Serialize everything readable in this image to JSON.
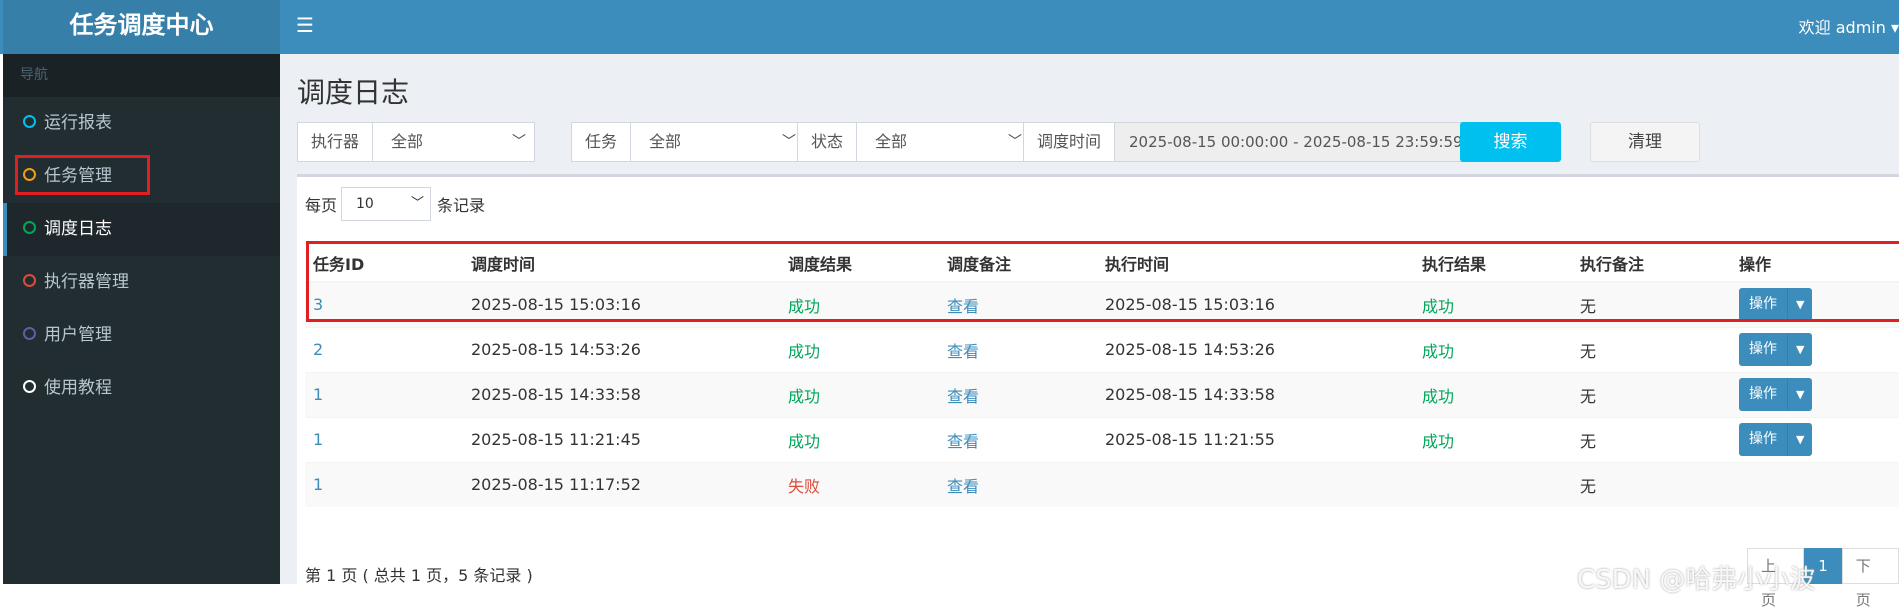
{
  "app": {
    "title": "任务调度中心",
    "menu_icon": "hamburger-icon",
    "welcome": "欢迎 admin"
  },
  "sidebar": {
    "header": "导航",
    "items": [
      {
        "label": "运行报表",
        "icon_color": "#00c0ef"
      },
      {
        "label": "任务管理",
        "icon_color": "#f39c12"
      },
      {
        "label": "调度日志",
        "icon_color": "#00a65a",
        "active": true
      },
      {
        "label": "执行器管理",
        "icon_color": "#dd4b39"
      },
      {
        "label": "用户管理",
        "icon_color": "#605ca8"
      },
      {
        "label": "使用教程",
        "icon_color": "#ffffff"
      }
    ]
  },
  "page": {
    "title": "调度日志"
  },
  "filters": {
    "executor_label": "执行器",
    "executor_value": "全部",
    "job_label": "任务",
    "job_value": "全部",
    "status_label": "状态",
    "status_value": "全部",
    "time_label": "调度时间",
    "time_value": "2025-08-15 00:00:00 - 2025-08-15 23:59:59",
    "search_label": "搜索",
    "clear_label": "清理"
  },
  "length": {
    "prefix": "每页",
    "value": "10",
    "suffix": "条记录"
  },
  "table": {
    "headers": [
      "任务ID",
      "调度时间",
      "调度结果",
      "调度备注",
      "执行时间",
      "执行结果",
      "执行备注",
      "操作"
    ],
    "rows": [
      {
        "id": "3",
        "trigger_time": "2025-08-15 15:03:16",
        "trigger_result": "成功",
        "trigger_note": "查看",
        "exec_time": "2025-08-15 15:03:16",
        "exec_result": "成功",
        "exec_note": "无",
        "op": "操作"
      },
      {
        "id": "2",
        "trigger_time": "2025-08-15 14:53:26",
        "trigger_result": "成功",
        "trigger_note": "查看",
        "exec_time": "2025-08-15 14:53:26",
        "exec_result": "成功",
        "exec_note": "无",
        "op": "操作"
      },
      {
        "id": "1",
        "trigger_time": "2025-08-15 14:33:58",
        "trigger_result": "成功",
        "trigger_note": "查看",
        "exec_time": "2025-08-15 14:33:58",
        "exec_result": "成功",
        "exec_note": "无",
        "op": "操作"
      },
      {
        "id": "1",
        "trigger_time": "2025-08-15 11:21:45",
        "trigger_result": "成功",
        "trigger_note": "查看",
        "exec_time": "2025-08-15 11:21:55",
        "exec_result": "成功",
        "exec_note": "无",
        "op": "操作"
      },
      {
        "id": "1",
        "trigger_time": "2025-08-15 11:17:52",
        "trigger_result": "失败",
        "trigger_note": "查看",
        "exec_time": "",
        "exec_result": "",
        "exec_note": "无",
        "op": ""
      }
    ]
  },
  "footer": {
    "info": "第 1 页 ( 总共 1 页，5 条记录 )",
    "prev": "上页",
    "page": "1",
    "next": "下页"
  },
  "watermark": "CSDN @哈弗小小波",
  "colors": {
    "accent": "#3c8dbc",
    "success": "#00a65a",
    "danger": "#dd4b39",
    "highlight": "#e02020"
  }
}
